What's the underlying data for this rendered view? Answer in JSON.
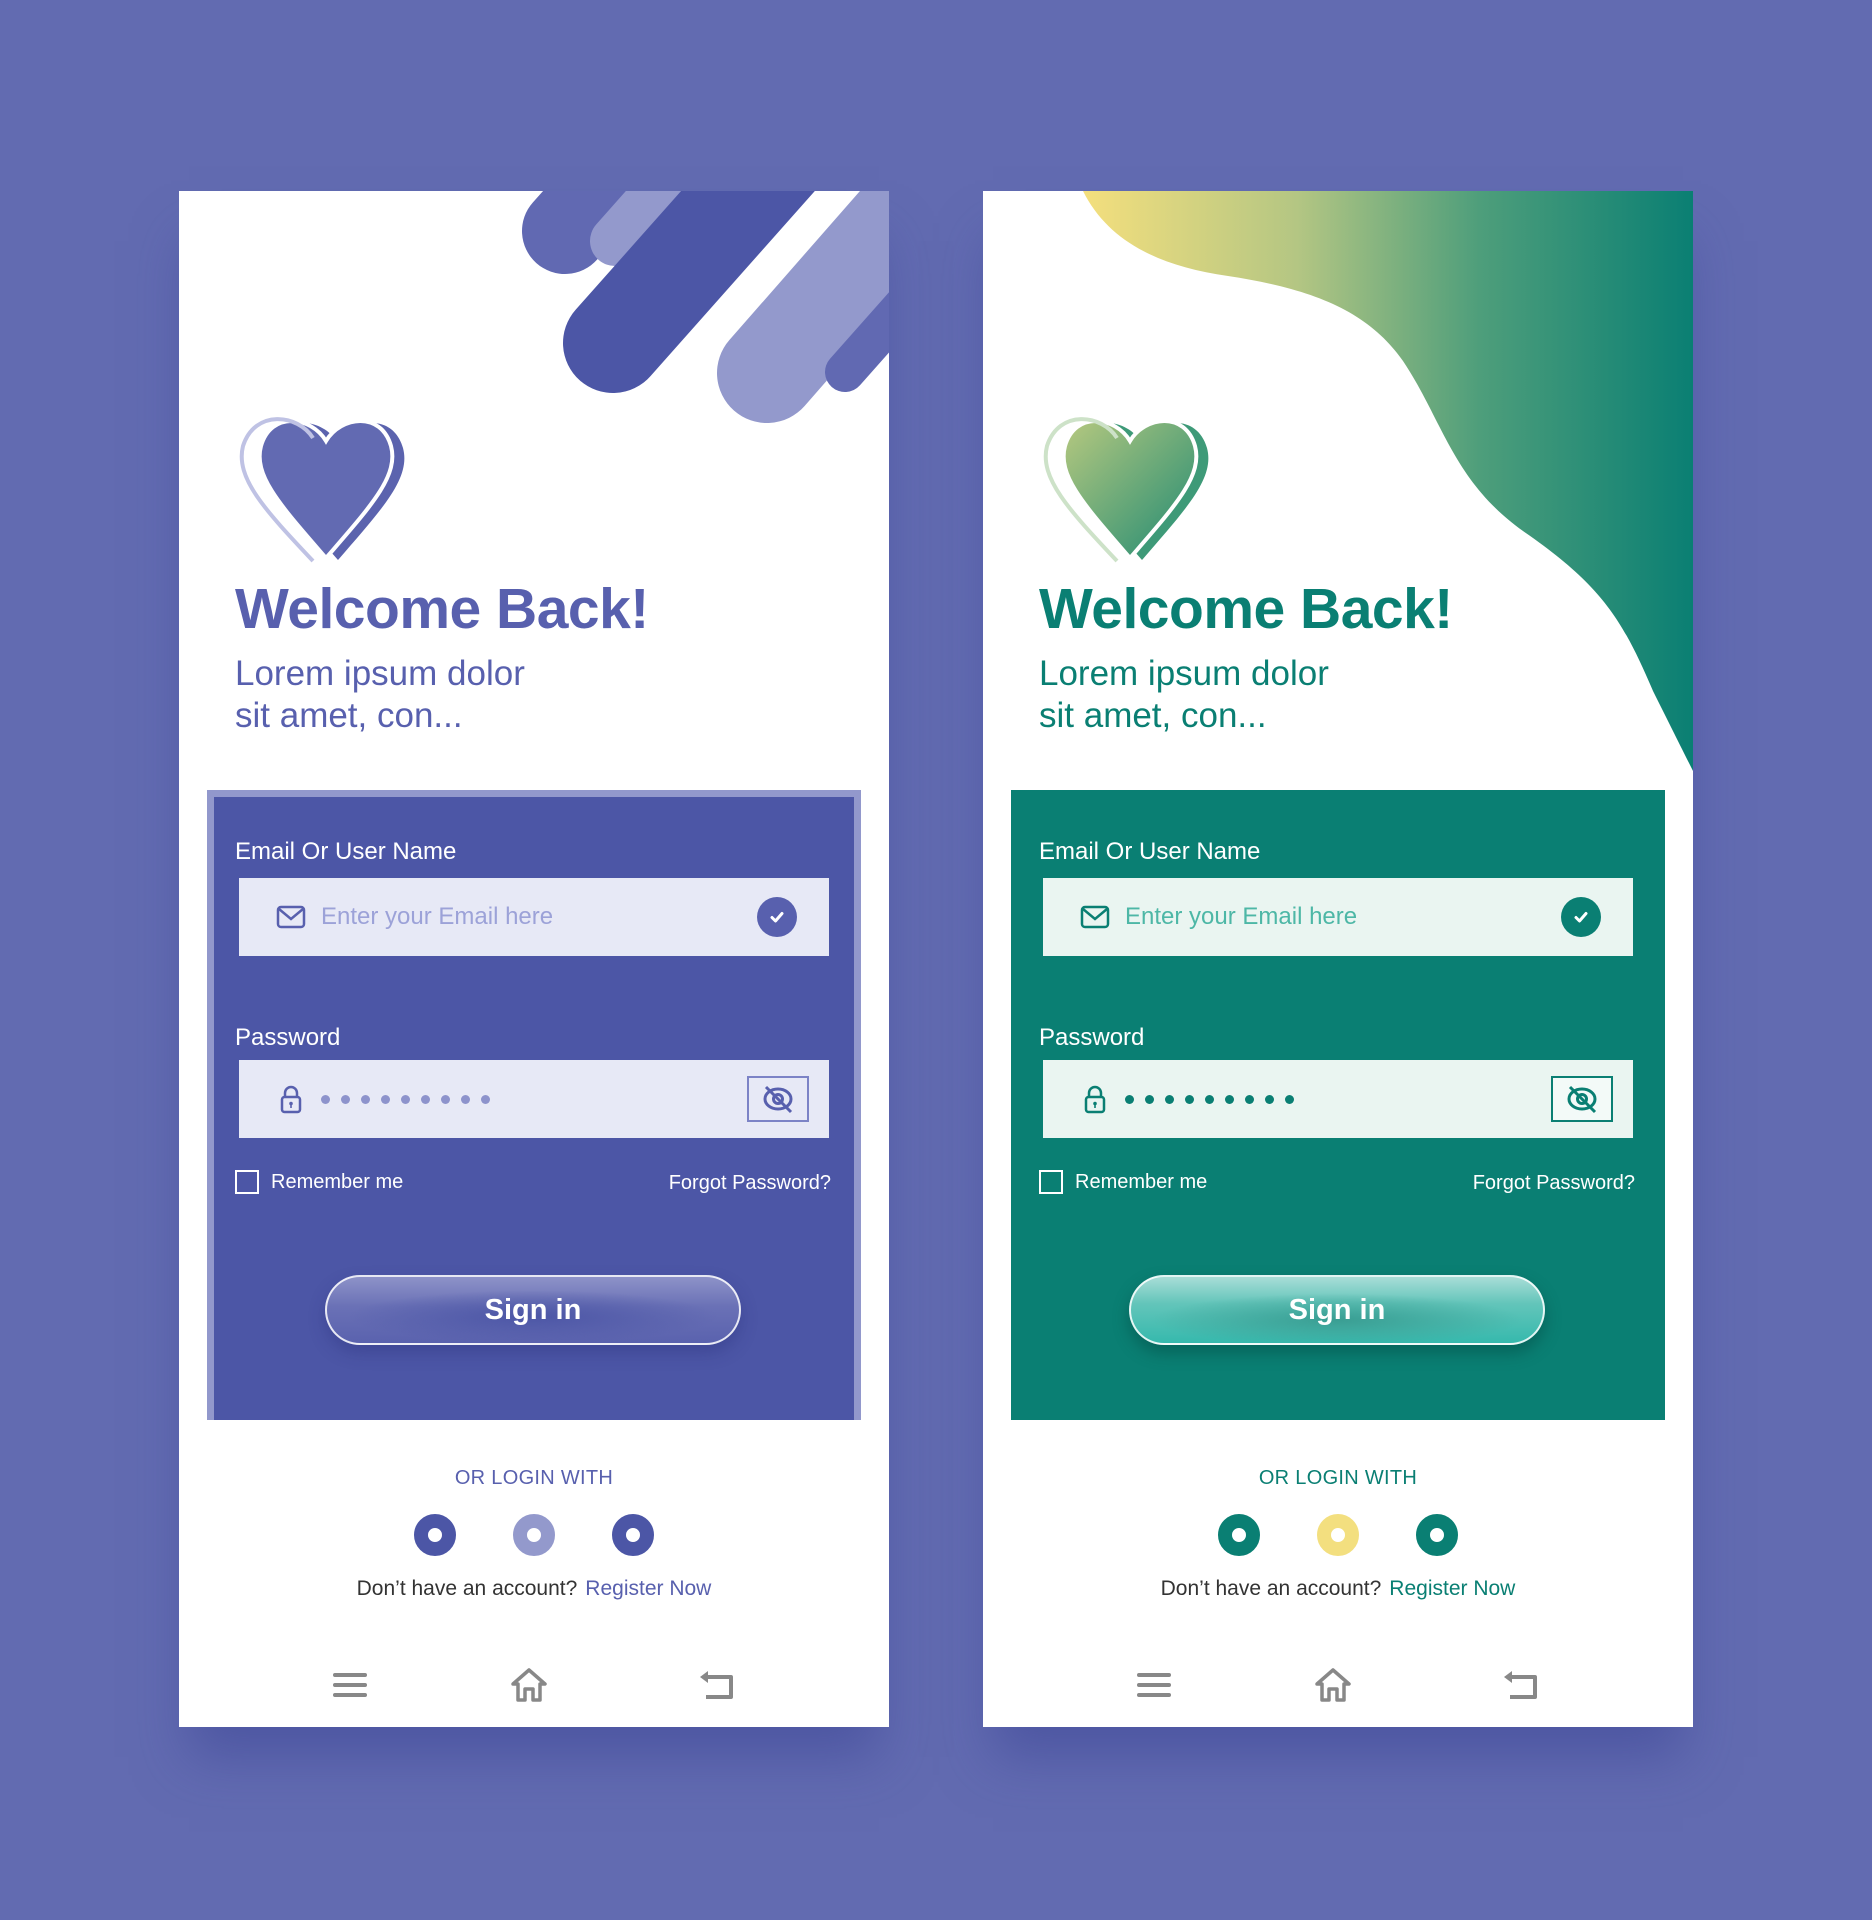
{
  "screens": [
    {
      "theme": "purple",
      "colors": {
        "primary": "#4C56A6",
        "accent": "#5860AE",
        "light": "#9399CC",
        "field_bg": "#E7E9F6",
        "placeholder": "#9CA2D8"
      },
      "header": {
        "title": "Welcome Back!",
        "subtitle": "Lorem ipsum dolor sit amet, con..."
      },
      "form": {
        "email_label": "Email Or User Name",
        "email_placeholder": "Enter your Email here",
        "email_icon": "mail-icon",
        "email_status_icon": "check-circle-icon",
        "password_label": "Password",
        "password_icon": "lock-icon",
        "password_masked_length": 9,
        "password_toggle_icon": "eye-off-icon",
        "remember_label": "Remember me",
        "remember_checked": false,
        "forgot_label": "Forgot Password?",
        "signin_label": "Sign in"
      },
      "social": {
        "label": "OR LOGIN WITH",
        "buttons": [
          {
            "icon": "social-login-1",
            "color": "#4C56A6"
          },
          {
            "icon": "social-login-2",
            "color": "#9399CC"
          },
          {
            "icon": "social-login-3",
            "color": "#4C56A6"
          }
        ]
      },
      "register": {
        "prompt": "Don’t have an account?",
        "link": "Register Now"
      },
      "bottom_nav": [
        {
          "icon": "menu-icon"
        },
        {
          "icon": "home-icon"
        },
        {
          "icon": "back-icon"
        }
      ]
    },
    {
      "theme": "teal",
      "colors": {
        "primary": "#0A7F73",
        "accent": "#0A7F73",
        "light": "#F3DF7F",
        "field_bg": "#EAF5F1",
        "placeholder": "#4DB7A6"
      },
      "header": {
        "title": "Welcome Back!",
        "subtitle": "Lorem ipsum dolor sit amet, con..."
      },
      "form": {
        "email_label": "Email Or User Name",
        "email_placeholder": "Enter your Email here",
        "email_icon": "mail-icon",
        "email_status_icon": "check-circle-icon",
        "password_label": "Password",
        "password_icon": "lock-icon",
        "password_masked_length": 9,
        "password_toggle_icon": "eye-off-icon",
        "remember_label": "Remember me",
        "remember_checked": false,
        "forgot_label": "Forgot Password?",
        "signin_label": "Sign in"
      },
      "social": {
        "label": "OR LOGIN WITH",
        "buttons": [
          {
            "icon": "social-login-1",
            "color": "#0A7F73"
          },
          {
            "icon": "social-login-2",
            "color": "#F3DF7F"
          },
          {
            "icon": "social-login-3",
            "color": "#0A7F73"
          }
        ]
      },
      "register": {
        "prompt": "Don’t have an account?",
        "link": "Register Now"
      },
      "bottom_nav": [
        {
          "icon": "menu-icon"
        },
        {
          "icon": "home-icon"
        },
        {
          "icon": "back-icon"
        }
      ]
    }
  ]
}
